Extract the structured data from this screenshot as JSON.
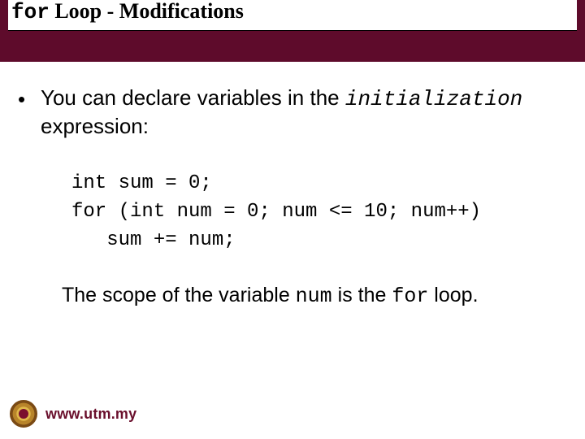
{
  "header": {
    "code_word": "for",
    "rest": " Loop - Modifications"
  },
  "bullet": {
    "marker": "•",
    "before": "You can declare variables in the ",
    "mono": "initialization",
    "after": " expression:"
  },
  "code": {
    "line1": "int sum = 0;",
    "line2": "for (int num = 0; num <= 10; num++)",
    "line3": "   sum += num;"
  },
  "scope": {
    "t1": "The scope of the variable ",
    "m1": "num",
    "t2": " is the ",
    "m2": "for",
    "t3": " loop."
  },
  "footer": {
    "site": "www.utm.my"
  }
}
